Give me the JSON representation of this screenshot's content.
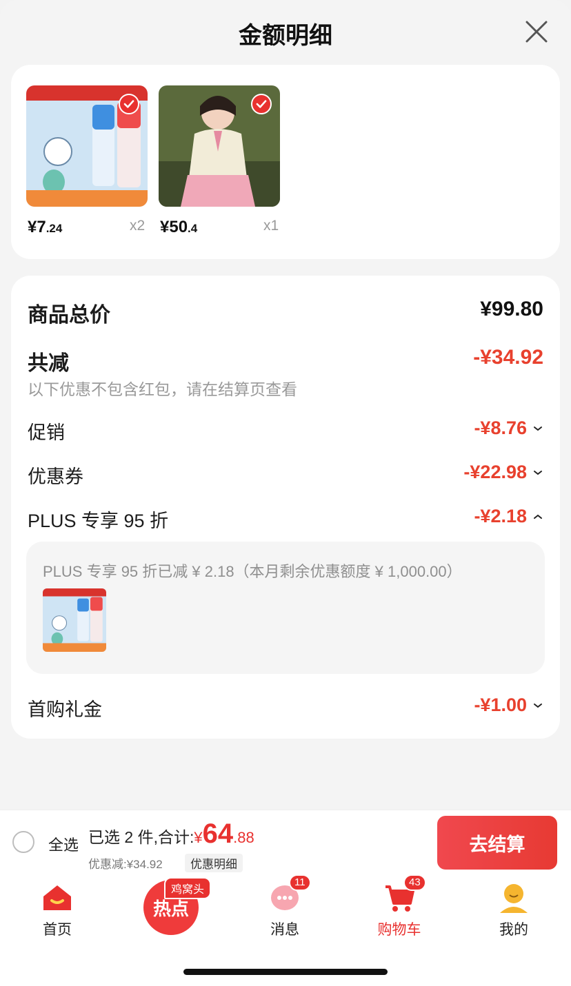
{
  "header": {
    "title": "金额明细"
  },
  "products": [
    {
      "price_int": "¥7",
      "price_dec": ".24",
      "qty": "x2"
    },
    {
      "price_int": "¥50",
      "price_dec": ".4",
      "qty": "x1"
    }
  ],
  "detail": {
    "total_label": "商品总价",
    "total_value": "¥99.80",
    "reduce_label": "共减",
    "reduce_value": "-¥34.92",
    "note": "以下优惠不包含红包，请在结算页查看",
    "promo_label": "促销",
    "promo_value": "-¥8.76",
    "coupon_label": "优惠券",
    "coupon_value": "-¥22.98",
    "plus_label": "PLUS 专享 95 折",
    "plus_value": "-¥2.18",
    "plus_note": "PLUS 专享 95 折已减 ¥ 2.18（本月剩余优惠额度 ¥ 1,000.00）",
    "first_label": "首购礼金",
    "first_value": "-¥1.00"
  },
  "checkout": {
    "select_all": "全选",
    "summary": "已选 2 件,合计:",
    "currency": "¥",
    "amount_int": "64",
    "amount_dec": ".88",
    "discount": "优惠减:¥34.92",
    "discount_detail": "优惠明细",
    "pay": "去结算"
  },
  "tabbar": {
    "home": "首页",
    "hot_label": "热点",
    "hot_badge": "鸡窝头",
    "messages": "消息",
    "messages_badge": "11",
    "cart": "购物车",
    "cart_badge": "43",
    "me": "我的"
  },
  "colors": {
    "accent": "#e8312f",
    "price_red": "#e8412e"
  },
  "icons": [
    "close-icon",
    "check-icon",
    "chevron-down-icon",
    "chevron-up-icon",
    "home-icon",
    "hot-icon",
    "message-icon",
    "cart-icon",
    "profile-icon"
  ]
}
